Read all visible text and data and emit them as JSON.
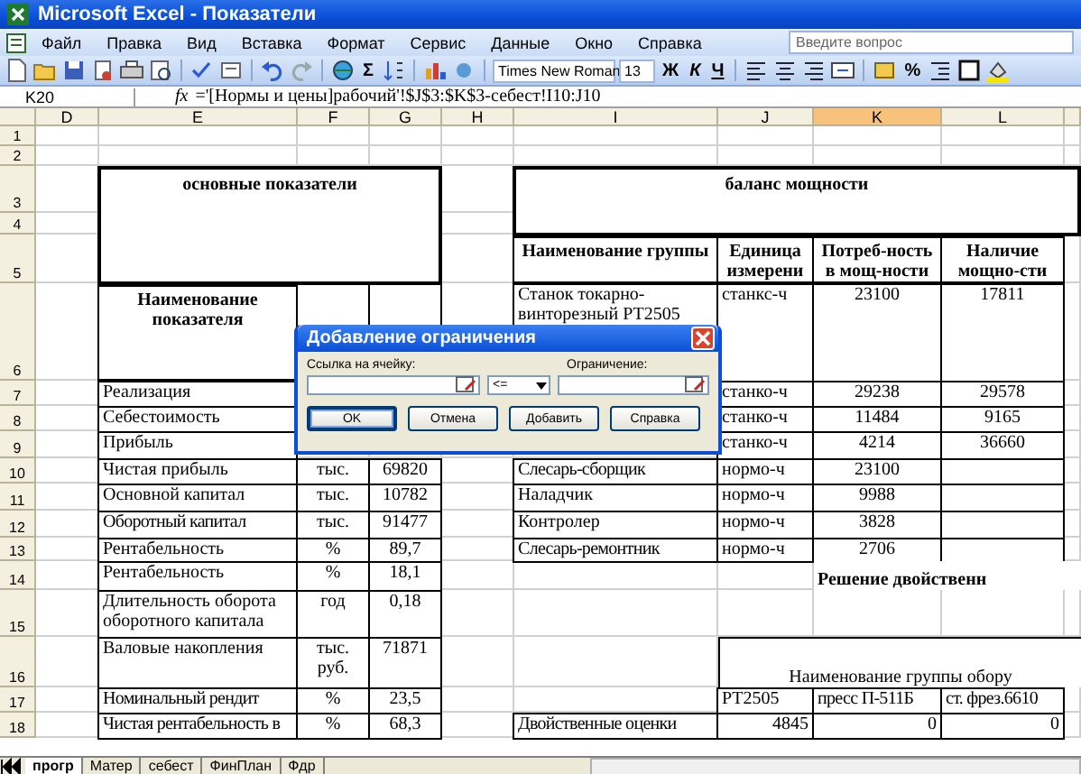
{
  "window": {
    "title": "Microsoft Excel - Показатели"
  },
  "menu": [
    "Файл",
    "Правка",
    "Вид",
    "Вставка",
    "Формат",
    "Сервис",
    "Данные",
    "Окно",
    "Справка"
  ],
  "help_search": {
    "placeholder": "Введите вопрос"
  },
  "toolbar": {
    "font": "Times New Roman",
    "size": "13",
    "sum": "Σ",
    "format_buttons": [
      "Ж",
      "К",
      "Ч"
    ],
    "percent": "%"
  },
  "formula_bar": {
    "name_box": "K20",
    "fx": "fx",
    "formula": "='[Нормы и цены]рабочий'!$J$3:$K$3-себест!I10:J10"
  },
  "columns": [
    {
      "label": "D",
      "selected": false
    },
    {
      "label": "E",
      "selected": false
    },
    {
      "label": "F",
      "selected": false
    },
    {
      "label": "G",
      "selected": false
    },
    {
      "label": "H",
      "selected": false
    },
    {
      "label": "I",
      "selected": false
    },
    {
      "label": "J",
      "selected": false
    },
    {
      "label": "K",
      "selected": true
    },
    {
      "label": "L",
      "selected": false
    }
  ],
  "rows": [
    "1",
    "2",
    "3",
    "4",
    "5",
    "6",
    "7",
    "8",
    "9",
    "10",
    "11",
    "12",
    "13",
    "14",
    "15",
    "16",
    "17",
    "18"
  ],
  "cells": [
    {
      "kind": "title",
      "text": "основные показатели"
    },
    {
      "kind": "title",
      "text": "баланс мощности"
    },
    {
      "kind": "head",
      "text": "Наименование группы"
    },
    {
      "kind": "head",
      "text": "Единица измерени"
    },
    {
      "kind": "head",
      "text": "Потреб-ность в мощ-ности"
    },
    {
      "kind": "head",
      "text": "Наличие мощно-сти"
    },
    {
      "kind": "head",
      "text": "Наименование показателя"
    },
    {
      "kind": "num"
    },
    {
      "kind": "num"
    },
    {
      "kind": "text",
      "text": "Станок токарно-винторезный РТ2505"
    },
    {
      "kind": "text",
      "text": "станкс-ч"
    },
    {
      "kind": "num",
      "text": "23100"
    },
    {
      "kind": "num",
      "text": "17811"
    },
    {
      "kind": "text",
      "text": "Реализация"
    },
    {
      "kind": "text",
      "text": "станко-ч"
    },
    {
      "kind": "num",
      "text": "29238"
    },
    {
      "kind": "num",
      "text": "29578"
    },
    {
      "kind": "text",
      "text": "Себестоимость"
    },
    {
      "kind": "text",
      "text": "станко-ч"
    },
    {
      "kind": "num",
      "text": "11484"
    },
    {
      "kind": "num",
      "text": "9165"
    },
    {
      "kind": "text",
      "text": "Прибыль"
    },
    {
      "kind": "text",
      "text": "станко-ч"
    },
    {
      "kind": "num",
      "text": "4214"
    },
    {
      "kind": "num",
      "text": "36660"
    },
    {
      "kind": "text",
      "text": "Чистая прибыль"
    },
    {
      "kind": "num",
      "text": "тыс."
    },
    {
      "kind": "num",
      "text": "69820"
    },
    {
      "kind": "text",
      "text": "Слесарь-сборщик"
    },
    {
      "kind": "text",
      "text": "нормо-ч"
    },
    {
      "kind": "num",
      "text": "23100"
    },
    {
      "kind": "num"
    },
    {
      "kind": "text",
      "text": "Основной капитал"
    },
    {
      "kind": "num",
      "text": "тыс."
    },
    {
      "kind": "num",
      "text": "10782"
    },
    {
      "kind": "text",
      "text": "Наладчик"
    },
    {
      "kind": "text",
      "text": "нормо-ч"
    },
    {
      "kind": "num",
      "text": "9988"
    },
    {
      "kind": "num"
    },
    {
      "kind": "text",
      "text": "Оборотный капитал"
    },
    {
      "kind": "num",
      "text": "тыс."
    },
    {
      "kind": "num",
      "text": "91477"
    },
    {
      "kind": "text",
      "text": "Контролер"
    },
    {
      "kind": "text",
      "text": "нормо-ч"
    },
    {
      "kind": "num",
      "text": "3828"
    },
    {
      "kind": "num"
    },
    {
      "kind": "text",
      "text": "Рентабельность"
    },
    {
      "kind": "num",
      "text": "%"
    },
    {
      "kind": "num",
      "text": "89,7"
    },
    {
      "kind": "text",
      "text": "Слесарь-ремонтник"
    },
    {
      "kind": "text",
      "text": "нормо-ч"
    },
    {
      "kind": "num",
      "text": "2706"
    },
    {
      "kind": "num"
    },
    {
      "kind": "text",
      "text": "Рентабельность"
    },
    {
      "kind": "num",
      "text": "%"
    },
    {
      "kind": "num",
      "text": "18,1"
    },
    {
      "kind": "caption",
      "text": "Решение двойственн"
    },
    {
      "kind": "text",
      "text": "Длительность оборота оборотного капитала"
    },
    {
      "kind": "num",
      "text": "год"
    },
    {
      "kind": "num",
      "text": "0,18"
    },
    {
      "kind": "text",
      "text": "Валовые накопления"
    },
    {
      "kind": "num",
      "text": "тыс. руб."
    },
    {
      "kind": "num",
      "text": "71871"
    },
    {
      "kind": "note",
      "text": "Наименование группы обору"
    },
    {
      "kind": "text",
      "text": "Номинальный рендит"
    },
    {
      "kind": "num",
      "text": "%"
    },
    {
      "kind": "num",
      "text": "23,5"
    },
    {
      "kind": "text",
      "text": "РТ2505"
    },
    {
      "kind": "text",
      "text": "пресс П-511Б"
    },
    {
      "kind": "text",
      "text": "ст. фрез.6610"
    },
    {
      "kind": "text",
      "text": "Чистая рентабельность в"
    },
    {
      "kind": "num",
      "text": "%"
    },
    {
      "kind": "num",
      "text": "68,3"
    },
    {
      "kind": "text",
      "text": "Двойственные оценки"
    },
    {
      "kind": "right",
      "text": "4845"
    },
    {
      "kind": "right",
      "text": "0"
    },
    {
      "kind": "right",
      "text": "0"
    }
  ],
  "dialog": {
    "title": "Добавление ограничения",
    "cell_ref_label": "Ссылка на ячейку:",
    "constraint_label": "Ограничение:",
    "operator": "<=",
    "buttons": [
      {
        "label": "OK",
        "focused": true
      },
      {
        "label": "Отмена",
        "focused": false
      },
      {
        "label": "Добавить",
        "focused": false
      },
      {
        "label": "Справка",
        "focused": false
      }
    ]
  },
  "sheet_tabs": [
    {
      "label": "прогр",
      "selected": true
    },
    {
      "label": "Матер",
      "selected": false
    },
    {
      "label": "себест",
      "selected": false
    },
    {
      "label": "ФинПлан",
      "selected": false
    },
    {
      "label": "Фдр",
      "selected": false
    }
  ]
}
